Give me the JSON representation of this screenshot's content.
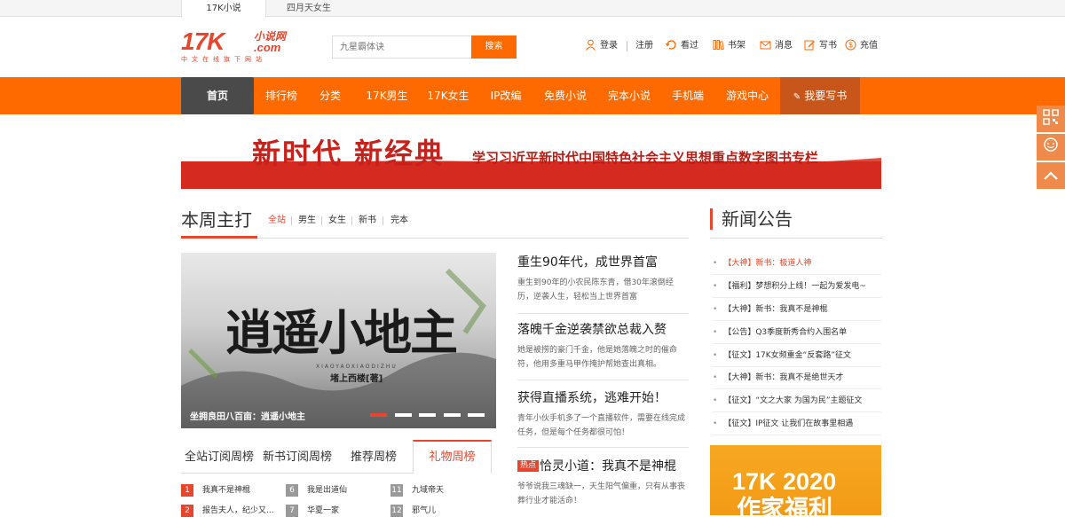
{
  "top_tabs": [
    {
      "label": "17K小说",
      "active": true
    },
    {
      "label": "四月天女生",
      "active": false
    }
  ],
  "logo": {
    "main": "17K",
    "side": "小说网",
    "com": ".com",
    "tagline": "中文在线旗下网站"
  },
  "search": {
    "placeholder": "九星霸体诀",
    "button_label": "搜索"
  },
  "user_links": [
    {
      "label": "登录",
      "icon": "user-icon"
    },
    {
      "label": "注册",
      "icon": ""
    },
    {
      "label": "看过",
      "icon": "history-icon"
    },
    {
      "label": "书架",
      "icon": "bookshelf-icon"
    },
    {
      "label": "消息",
      "icon": "message-icon"
    },
    {
      "label": "写书",
      "icon": "write-icon"
    },
    {
      "label": "充值",
      "icon": "coin-icon"
    }
  ],
  "nav": {
    "home": "首页",
    "items": [
      "排行榜",
      "分类",
      "17K男生",
      "17K女生",
      "IP改编",
      "免费小说",
      "完本小说",
      "手机端",
      "游戏中心"
    ],
    "write": "我要写书"
  },
  "banner": {
    "title": "新时代 新经典",
    "subtitle": "学习习近平新时代中国特色社会主义思想重点数字图书专栏"
  },
  "weekly": {
    "title": "本周主打",
    "tabs": [
      "全站",
      "男生",
      "女生",
      "新书",
      "完本"
    ],
    "active_tab": "全站"
  },
  "hero": {
    "title": "逍遥小地主",
    "latin": "XIAOYAOXIAODIZHU",
    "author": "堵上西楼[著]",
    "caption": "坐拥良田八百亩：逍遥小地主",
    "slides": 5,
    "active_slide": 1
  },
  "stories": [
    {
      "title": "重生90年代，成世界首富",
      "desc": "重生到90年的小农民陈东青，借30年滚倒经历，逆袭人生，轻松当上世界首富",
      "hot": false
    },
    {
      "title": "落魄千金逆袭禁欲总裁入赘",
      "desc": "她是被捞的豪门千金，他是她落魄之时的催命符，他用多重马甲作掩护帮她查出真相。",
      "hot": false
    },
    {
      "title": "获得直播系统，逃难开始！",
      "desc": "青年小伙手机多了一个直播软件，需要在线完成任务，但是每个任务都很可怕！",
      "hot": false
    },
    {
      "title": "恰灵小道：我真不是神棍",
      "desc": "爷爷说我三魂缺一，天生阳气偏重，只有从事丧葬行业才能活命！",
      "hot": true,
      "hot_label": "热点"
    }
  ],
  "rank_tabs": [
    {
      "label": "全站订阅周榜",
      "active": false
    },
    {
      "label": "新书订阅周榜",
      "active": false
    },
    {
      "label": "推荐周榜",
      "active": false
    },
    {
      "label": "礼物周榜",
      "active": true
    }
  ],
  "rank_items": [
    {
      "num": "1",
      "title": "我真不是神棍",
      "color": "#e8452c"
    },
    {
      "num": "2",
      "title": "报告夫人，纪少又...",
      "color": "#e8452c"
    },
    {
      "num": "6",
      "title": "我是出道仙",
      "color": "#999999"
    },
    {
      "num": "7",
      "title": "华夏一家",
      "color": "#999999"
    },
    {
      "num": "11",
      "title": "九域帝天",
      "color": "#999999"
    },
    {
      "num": "12",
      "title": "邪气儿",
      "color": "#999999"
    }
  ],
  "news": {
    "title": "新闻公告",
    "items": [
      {
        "text": "【大神】新书：极道人神",
        "highlight": true
      },
      {
        "text": "【福利】梦想积分上线！一起为爱发电~",
        "highlight": false
      },
      {
        "text": "【大神】新书：我真不是神棍",
        "highlight": false
      },
      {
        "text": "【公告】Q3季度新秀合约入围名单",
        "highlight": false
      },
      {
        "text": "【征文】17K女频重金“反套路”征文",
        "highlight": false
      },
      {
        "text": "【大神】新书：我真不是绝世天才",
        "highlight": false
      },
      {
        "text": "【征文】“文之大家 为国为民”主题征文",
        "highlight": false
      },
      {
        "text": "【征文】IP征文 让我们在故事里相遇",
        "highlight": false
      }
    ]
  },
  "ad": {
    "line1": "17K 2020",
    "line2": "作家福利"
  },
  "colors": {
    "accent": "#ff6a00",
    "brand_red": "#e8452c",
    "nav_dark": "#4a4a4a"
  }
}
